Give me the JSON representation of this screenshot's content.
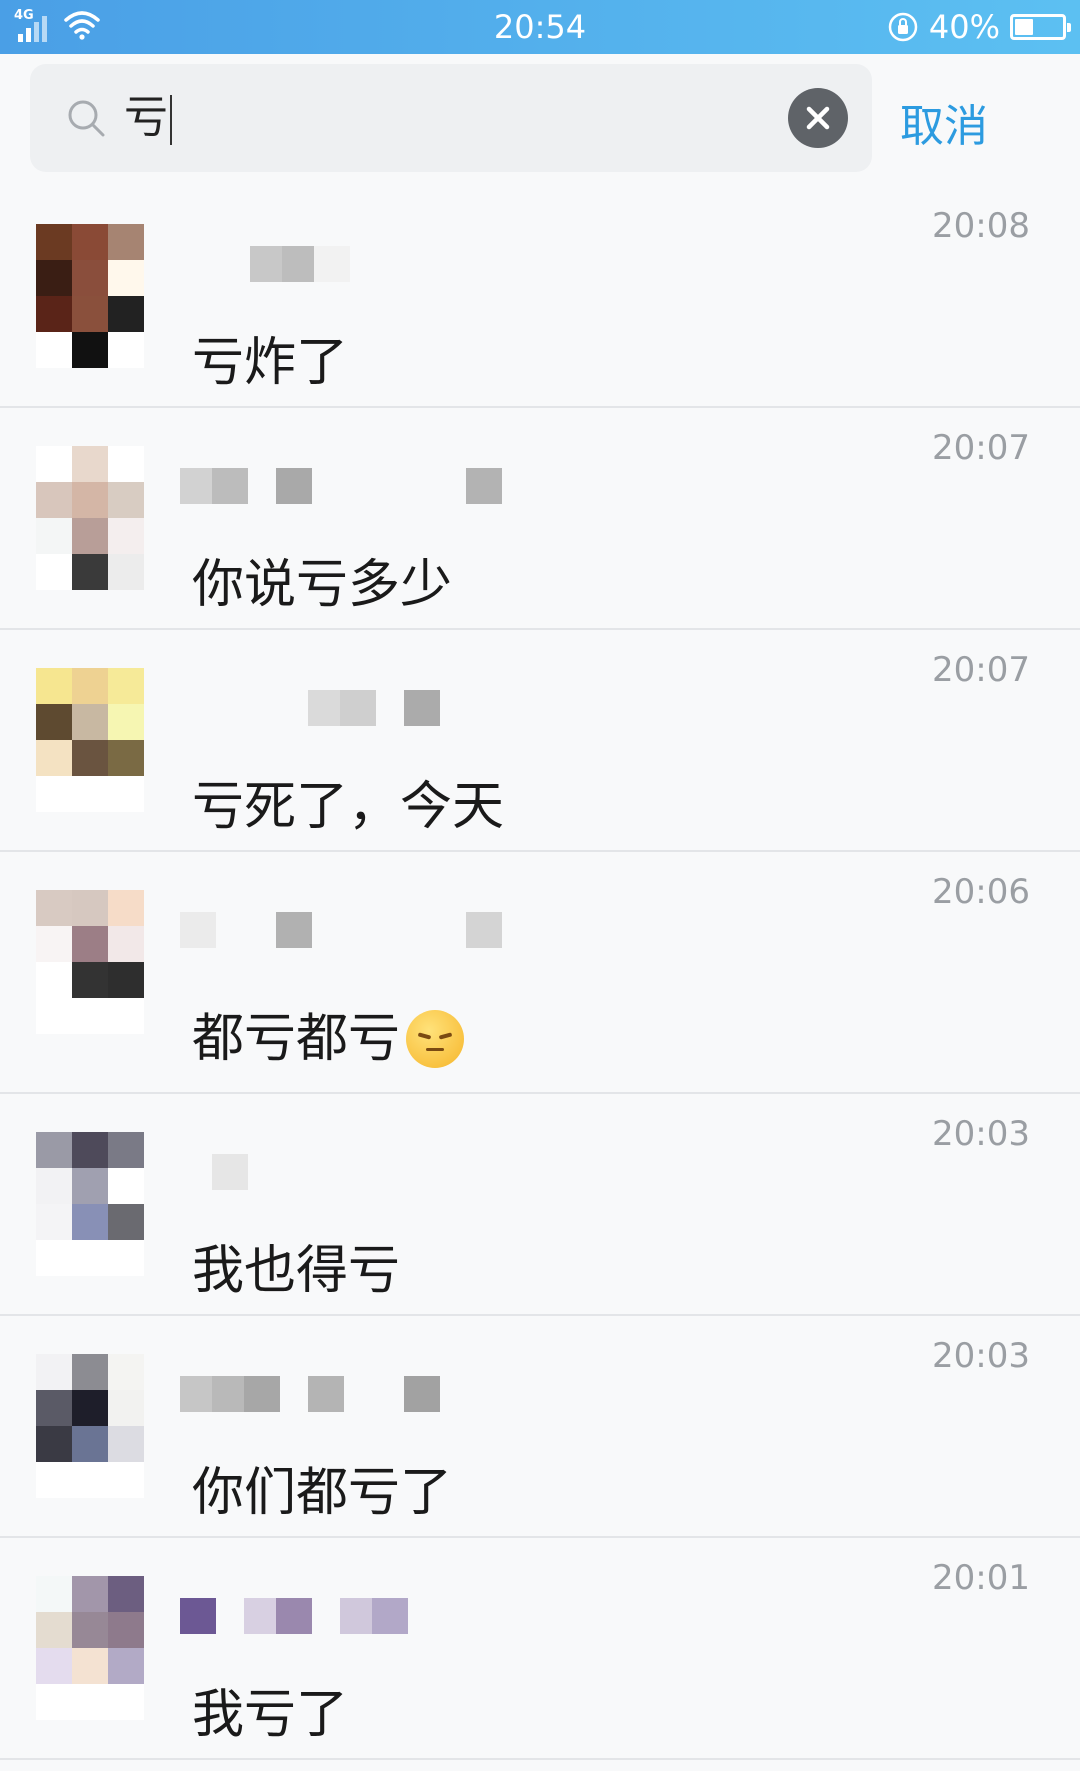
{
  "status_bar": {
    "network": "4G",
    "time": "20:54",
    "battery_text": "40%",
    "battery_level": 0.4
  },
  "search": {
    "query": "亏",
    "cancel_label": "取消"
  },
  "results": [
    {
      "time": "20:08",
      "message": "亏炸了",
      "avatar": [
        "#6b3a22",
        "#8a4a36",
        "#a68472",
        "#3a1e14",
        "#8a4e3c",
        "#fff8ec",
        "#5a2418",
        "#8a503c",
        "#222222",
        "#ffffff",
        "#111111",
        "#ffffff"
      ],
      "name_blocks": [
        {
          "c": "#c8c8c8"
        },
        {
          "c": "#bdbdbd"
        },
        {
          "c": "#f2f2f2"
        }
      ]
    },
    {
      "time": "20:07",
      "message": "你说亏多少",
      "avatar": [
        "#ffffff",
        "#e8d8cc",
        "#ffffff",
        "#d8c6bc",
        "#d4b6a6",
        "#d8ccc2",
        "#f4f6f6",
        "#b89e98",
        "#f4eeee",
        "#ffffff",
        "#3a3a3a",
        "#ececec"
      ],
      "name_blocks": [
        {
          "c": "#d2d2d2"
        },
        {
          "c": "#bcbcbc"
        },
        {
          "c": "#a9a9a9"
        },
        {
          "c": "#b3b3b3"
        }
      ]
    },
    {
      "time": "20:07",
      "message": "亏死了，今天",
      "avatar": [
        "#f6e690",
        "#eed292",
        "#f6ea98",
        "#5e4a30",
        "#c8b8a2",
        "#f6f6b2",
        "#f4e2c2",
        "#6a5440",
        "#7a6a44",
        "#ffffff",
        "#ffffff",
        "#ffffff"
      ],
      "name_blocks": [
        {
          "c": "#dadada"
        },
        {
          "c": "#cfcfcf"
        },
        {
          "c": "#ababab"
        }
      ]
    },
    {
      "time": "20:06",
      "message": "都亏都亏",
      "emoji": "pensive",
      "avatar": [
        "#d8cac2",
        "#d6c8c0",
        "#f6dcc8",
        "#f8f4f4",
        "#9c7e86",
        "#f2e8e8",
        "#ffffff",
        "#333333",
        "#2e2e2e",
        "#ffffff",
        "#ffffff",
        "#ffffff"
      ],
      "name_blocks": [
        {
          "c": "#ebebeb"
        },
        {
          "c": "#b1b1b1"
        },
        {
          "c": "#d4d4d4"
        }
      ]
    },
    {
      "time": "20:03",
      "message": "我也得亏",
      "avatar": [
        "#9a9aa6",
        "#4e4a5a",
        "#7a7a86",
        "#f2f2f4",
        "#a0a0b0",
        "#ffffff",
        "#f4f4f6",
        "#8890b6",
        "#6a6a70",
        "#ffffff",
        "#ffffff",
        "#ffffff"
      ],
      "name_blocks": [
        {
          "c": "#e6e6e6"
        }
      ]
    },
    {
      "time": "20:03",
      "message": "你们都亏了",
      "avatar": [
        "#f2f2f4",
        "#8c8c92",
        "#f4f4f2",
        "#5a5a66",
        "#1e1e2a",
        "#f2f2f0",
        "#3a3a44",
        "#6a7494",
        "#dcdce2",
        "#ffffff",
        "#ffffff",
        "#ffffff"
      ],
      "name_blocks": [
        {
          "c": "#c6c6c6"
        },
        {
          "c": "#b9b9b9"
        },
        {
          "c": "#a7a7a7"
        },
        {
          "c": "#b4b4b4"
        },
        {
          "c": "#a2a2a2"
        }
      ]
    },
    {
      "time": "20:01",
      "message": "我亏了",
      "avatar": [
        "#f4f8f8",
        "#a296aa",
        "#6c5e80",
        "#e4dcd0",
        "#978896",
        "#8e7a8c",
        "#e4dcee",
        "#f4e2d2",
        "#b2aac6",
        "#ffffff",
        "#ffffff",
        "#ffffff"
      ],
      "name_blocks": [
        {
          "c": "#6c5894"
        },
        {
          "c": "#d8d0e2"
        },
        {
          "c": "#9a88ae"
        },
        {
          "c": "#d0c8dc"
        },
        {
          "c": "#b2a8c8"
        }
      ]
    }
  ]
}
